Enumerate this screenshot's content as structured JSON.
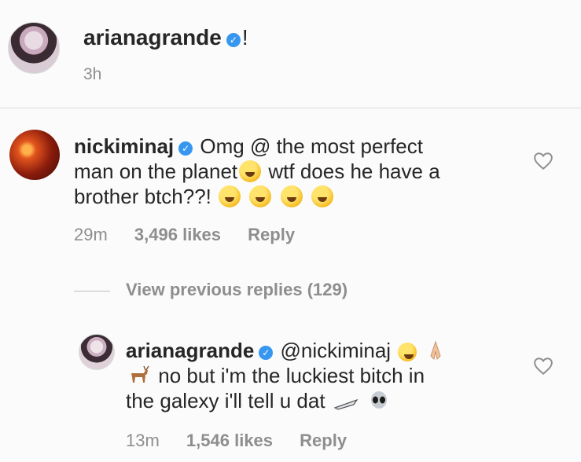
{
  "caption": {
    "username": "arianagrande",
    "text": "!",
    "time": "3h"
  },
  "comment": {
    "username": "nickiminaj",
    "text_line1": "Omg @ the most perfect",
    "text_line2a": "man on the planet",
    "text_line2b": "wtf does he have a",
    "text_line3": "brother btch??!",
    "time": "29m",
    "likes": "3,496 likes",
    "reply_label": "Reply"
  },
  "view_replies": "View previous replies (129)",
  "reply": {
    "username": "arianagrande",
    "mention": "@nickiminaj",
    "text_line2": "no but i'm the luckiest bitch in",
    "text_line3": "the galexy i'll tell u dat",
    "time": "13m",
    "likes": "1,546 likes",
    "reply_label": "Reply"
  },
  "icons": {
    "verified": "verified-badge-icon",
    "heart": "heart-outline-icon"
  },
  "colors": {
    "verified": "#3797f0",
    "muted": "#8e8e8e",
    "text": "#262626"
  }
}
